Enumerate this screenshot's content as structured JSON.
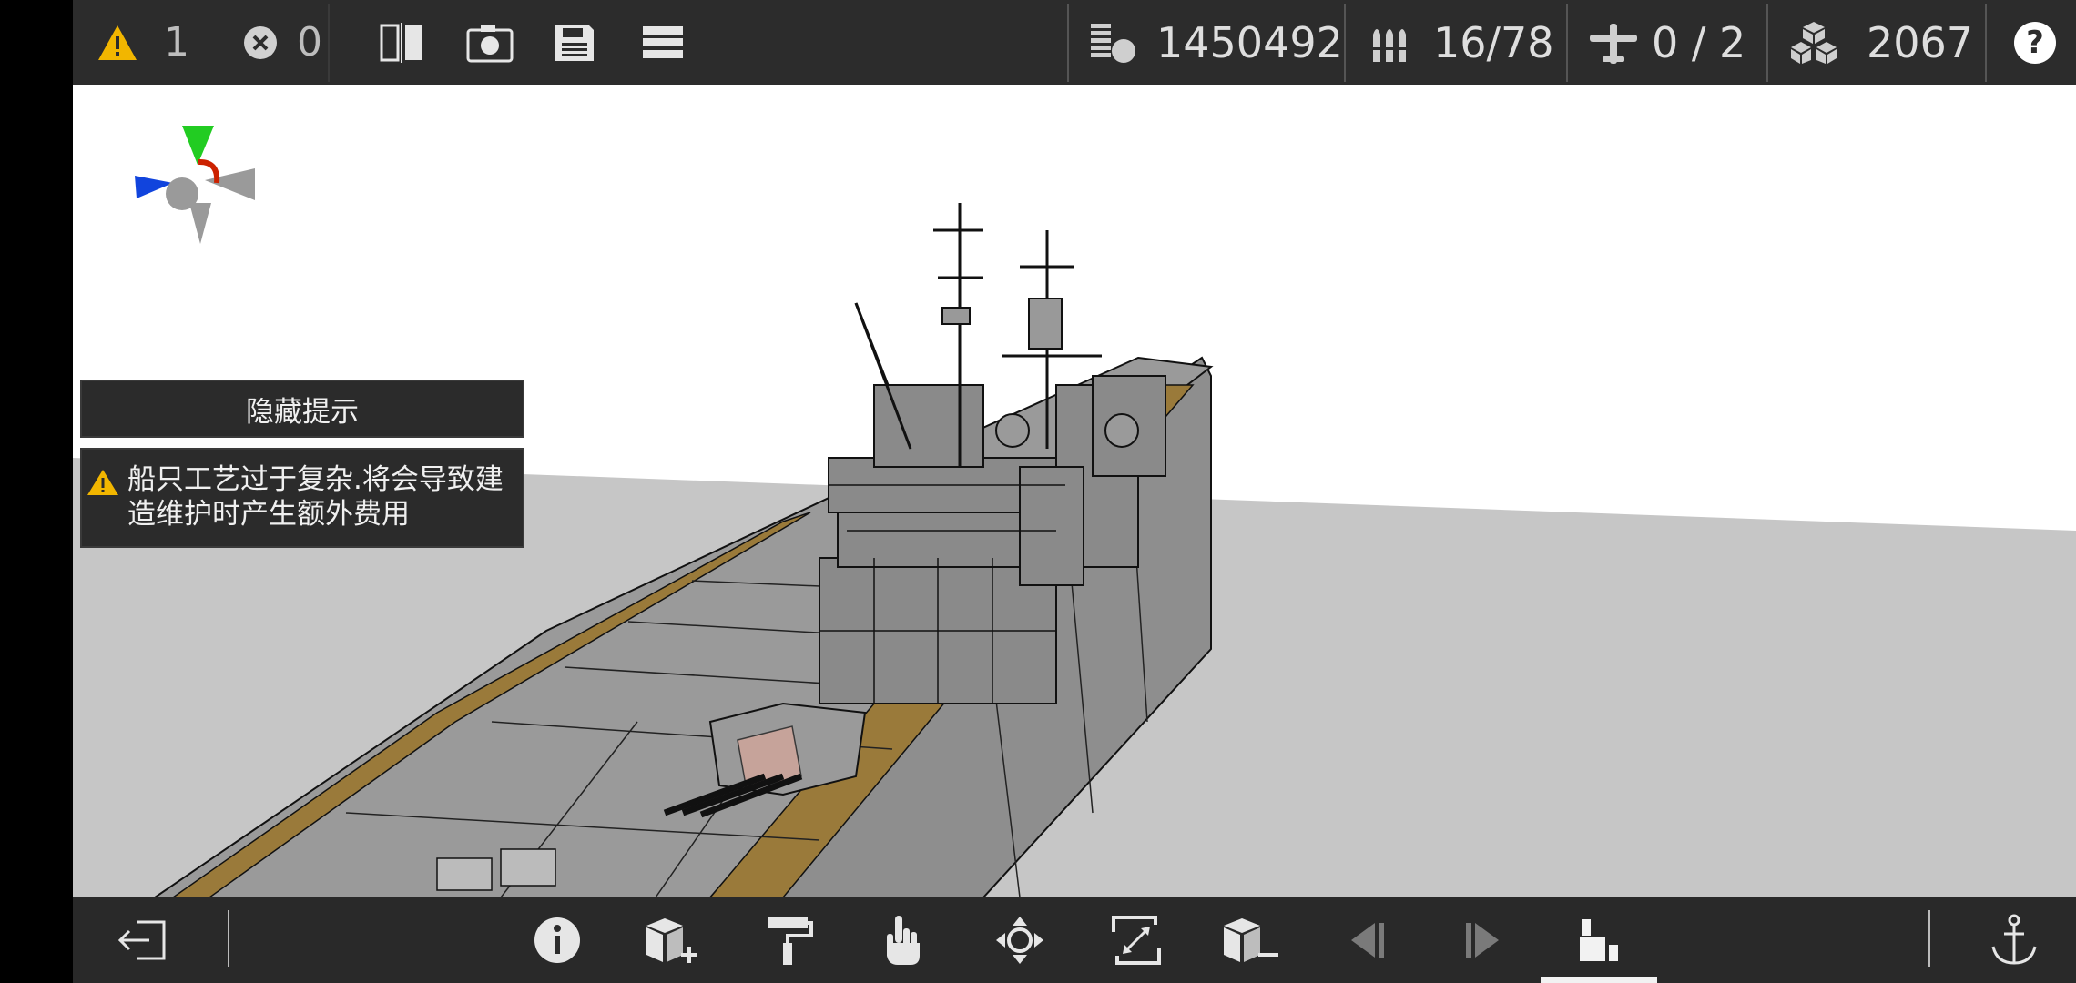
{
  "topbar": {
    "warnings": {
      "icon": "warning-icon",
      "count": "1"
    },
    "errors": {
      "icon": "error-icon",
      "count": "0"
    },
    "tools": [
      {
        "name": "mirror-icon"
      },
      {
        "name": "camera-icon"
      },
      {
        "name": "save-icon"
      },
      {
        "name": "menu-icon"
      }
    ],
    "stats": {
      "displacement": {
        "icon": "displacement-icon",
        "value": "1450492"
      },
      "ammo": {
        "icon": "ammo-icon",
        "value": "16/78"
      },
      "aircraft": {
        "icon": "aircraft-icon",
        "value": "0 / 2"
      },
      "parts": {
        "icon": "parts-icon",
        "value": "2067"
      }
    },
    "help_label": "?"
  },
  "hint": {
    "hide_label": "隐藏提示",
    "message": "船只工艺过于复杂.将会导致建造维护时产生额外费用"
  },
  "bottombar": {
    "items": [
      {
        "name": "exit-icon"
      },
      {
        "name": "info-icon"
      },
      {
        "name": "add-part-icon"
      },
      {
        "name": "paint-roller-icon"
      },
      {
        "name": "hand-select-icon"
      },
      {
        "name": "move-icon"
      },
      {
        "name": "scale-icon"
      },
      {
        "name": "remove-part-icon"
      },
      {
        "name": "undo-icon",
        "disabled": true
      },
      {
        "name": "redo-icon",
        "disabled": true
      },
      {
        "name": "build-mode-icon",
        "active": true
      },
      {
        "name": "anchor-icon"
      }
    ]
  },
  "colors": {
    "bar_bg": "#2c2c2c",
    "icon": "#e6e6e6",
    "warning": "#f2b600",
    "deck_wood": "#9a7a3a",
    "hull_gray": "#8c8c8c",
    "water_gray": "#c6c6c6",
    "axis_x": "#1144dd",
    "axis_y": "#22cc22",
    "axis_rot": "#cc2200"
  }
}
